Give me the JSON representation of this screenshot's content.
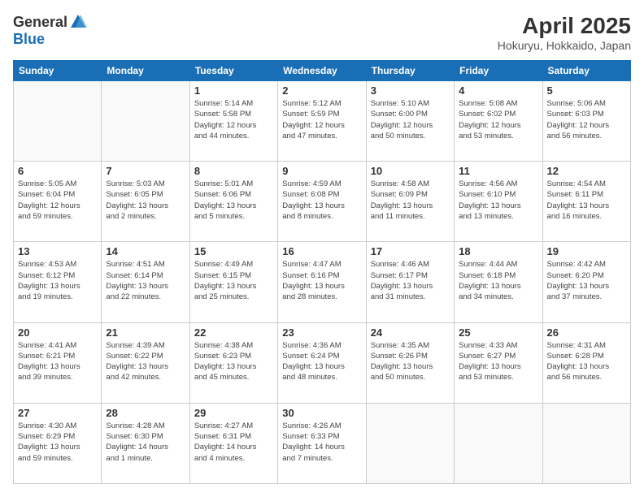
{
  "header": {
    "logo_general": "General",
    "logo_blue": "Blue",
    "title": "April 2025",
    "location": "Hokuryu, Hokkaido, Japan"
  },
  "weekdays": [
    "Sunday",
    "Monday",
    "Tuesday",
    "Wednesday",
    "Thursday",
    "Friday",
    "Saturday"
  ],
  "weeks": [
    [
      {
        "day": "",
        "info": ""
      },
      {
        "day": "",
        "info": ""
      },
      {
        "day": "1",
        "info": "Sunrise: 5:14 AM\nSunset: 5:58 PM\nDaylight: 12 hours\nand 44 minutes."
      },
      {
        "day": "2",
        "info": "Sunrise: 5:12 AM\nSunset: 5:59 PM\nDaylight: 12 hours\nand 47 minutes."
      },
      {
        "day": "3",
        "info": "Sunrise: 5:10 AM\nSunset: 6:00 PM\nDaylight: 12 hours\nand 50 minutes."
      },
      {
        "day": "4",
        "info": "Sunrise: 5:08 AM\nSunset: 6:02 PM\nDaylight: 12 hours\nand 53 minutes."
      },
      {
        "day": "5",
        "info": "Sunrise: 5:06 AM\nSunset: 6:03 PM\nDaylight: 12 hours\nand 56 minutes."
      }
    ],
    [
      {
        "day": "6",
        "info": "Sunrise: 5:05 AM\nSunset: 6:04 PM\nDaylight: 12 hours\nand 59 minutes."
      },
      {
        "day": "7",
        "info": "Sunrise: 5:03 AM\nSunset: 6:05 PM\nDaylight: 13 hours\nand 2 minutes."
      },
      {
        "day": "8",
        "info": "Sunrise: 5:01 AM\nSunset: 6:06 PM\nDaylight: 13 hours\nand 5 minutes."
      },
      {
        "day": "9",
        "info": "Sunrise: 4:59 AM\nSunset: 6:08 PM\nDaylight: 13 hours\nand 8 minutes."
      },
      {
        "day": "10",
        "info": "Sunrise: 4:58 AM\nSunset: 6:09 PM\nDaylight: 13 hours\nand 11 minutes."
      },
      {
        "day": "11",
        "info": "Sunrise: 4:56 AM\nSunset: 6:10 PM\nDaylight: 13 hours\nand 13 minutes."
      },
      {
        "day": "12",
        "info": "Sunrise: 4:54 AM\nSunset: 6:11 PM\nDaylight: 13 hours\nand 16 minutes."
      }
    ],
    [
      {
        "day": "13",
        "info": "Sunrise: 4:53 AM\nSunset: 6:12 PM\nDaylight: 13 hours\nand 19 minutes."
      },
      {
        "day": "14",
        "info": "Sunrise: 4:51 AM\nSunset: 6:14 PM\nDaylight: 13 hours\nand 22 minutes."
      },
      {
        "day": "15",
        "info": "Sunrise: 4:49 AM\nSunset: 6:15 PM\nDaylight: 13 hours\nand 25 minutes."
      },
      {
        "day": "16",
        "info": "Sunrise: 4:47 AM\nSunset: 6:16 PM\nDaylight: 13 hours\nand 28 minutes."
      },
      {
        "day": "17",
        "info": "Sunrise: 4:46 AM\nSunset: 6:17 PM\nDaylight: 13 hours\nand 31 minutes."
      },
      {
        "day": "18",
        "info": "Sunrise: 4:44 AM\nSunset: 6:18 PM\nDaylight: 13 hours\nand 34 minutes."
      },
      {
        "day": "19",
        "info": "Sunrise: 4:42 AM\nSunset: 6:20 PM\nDaylight: 13 hours\nand 37 minutes."
      }
    ],
    [
      {
        "day": "20",
        "info": "Sunrise: 4:41 AM\nSunset: 6:21 PM\nDaylight: 13 hours\nand 39 minutes."
      },
      {
        "day": "21",
        "info": "Sunrise: 4:39 AM\nSunset: 6:22 PM\nDaylight: 13 hours\nand 42 minutes."
      },
      {
        "day": "22",
        "info": "Sunrise: 4:38 AM\nSunset: 6:23 PM\nDaylight: 13 hours\nand 45 minutes."
      },
      {
        "day": "23",
        "info": "Sunrise: 4:36 AM\nSunset: 6:24 PM\nDaylight: 13 hours\nand 48 minutes."
      },
      {
        "day": "24",
        "info": "Sunrise: 4:35 AM\nSunset: 6:26 PM\nDaylight: 13 hours\nand 50 minutes."
      },
      {
        "day": "25",
        "info": "Sunrise: 4:33 AM\nSunset: 6:27 PM\nDaylight: 13 hours\nand 53 minutes."
      },
      {
        "day": "26",
        "info": "Sunrise: 4:31 AM\nSunset: 6:28 PM\nDaylight: 13 hours\nand 56 minutes."
      }
    ],
    [
      {
        "day": "27",
        "info": "Sunrise: 4:30 AM\nSunset: 6:29 PM\nDaylight: 13 hours\nand 59 minutes."
      },
      {
        "day": "28",
        "info": "Sunrise: 4:28 AM\nSunset: 6:30 PM\nDaylight: 14 hours\nand 1 minute."
      },
      {
        "day": "29",
        "info": "Sunrise: 4:27 AM\nSunset: 6:31 PM\nDaylight: 14 hours\nand 4 minutes."
      },
      {
        "day": "30",
        "info": "Sunrise: 4:26 AM\nSunset: 6:33 PM\nDaylight: 14 hours\nand 7 minutes."
      },
      {
        "day": "",
        "info": ""
      },
      {
        "day": "",
        "info": ""
      },
      {
        "day": "",
        "info": ""
      }
    ]
  ]
}
